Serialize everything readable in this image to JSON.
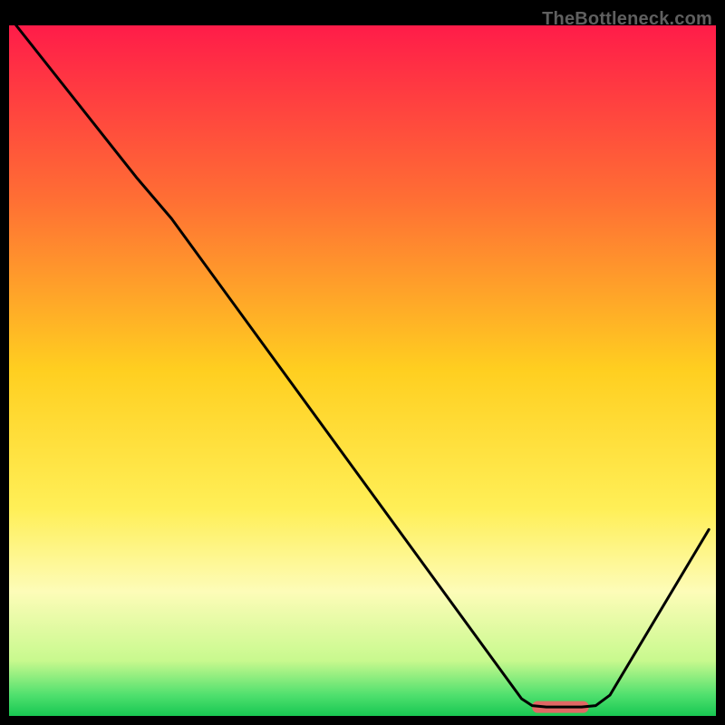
{
  "watermark": "TheBottleneck.com",
  "chart_data": {
    "type": "line",
    "title": "",
    "xlabel": "",
    "ylabel": "",
    "x_range": [
      0,
      100
    ],
    "y_range": [
      0,
      100
    ],
    "gradient_stops": [
      {
        "offset": 0,
        "color": "#ff1c49"
      },
      {
        "offset": 25,
        "color": "#ff6e34"
      },
      {
        "offset": 50,
        "color": "#ffcf20"
      },
      {
        "offset": 70,
        "color": "#ffef57"
      },
      {
        "offset": 82,
        "color": "#fdfcb8"
      },
      {
        "offset": 92,
        "color": "#c8f98e"
      },
      {
        "offset": 97,
        "color": "#4fe06e"
      },
      {
        "offset": 100,
        "color": "#18c752"
      }
    ],
    "curve": [
      {
        "x": 1.0,
        "y": 100.0
      },
      {
        "x": 18.0,
        "y": 78.0
      },
      {
        "x": 23.0,
        "y": 72.0
      },
      {
        "x": 72.5,
        "y": 2.5
      },
      {
        "x": 74.0,
        "y": 1.5
      },
      {
        "x": 76.0,
        "y": 1.3
      },
      {
        "x": 81.0,
        "y": 1.3
      },
      {
        "x": 83.0,
        "y": 1.5
      },
      {
        "x": 85.0,
        "y": 3.0
      },
      {
        "x": 99.0,
        "y": 27.0
      }
    ],
    "marker": {
      "x_start": 74.0,
      "x_end": 82.0,
      "y": 1.3,
      "color": "#e16864"
    }
  }
}
